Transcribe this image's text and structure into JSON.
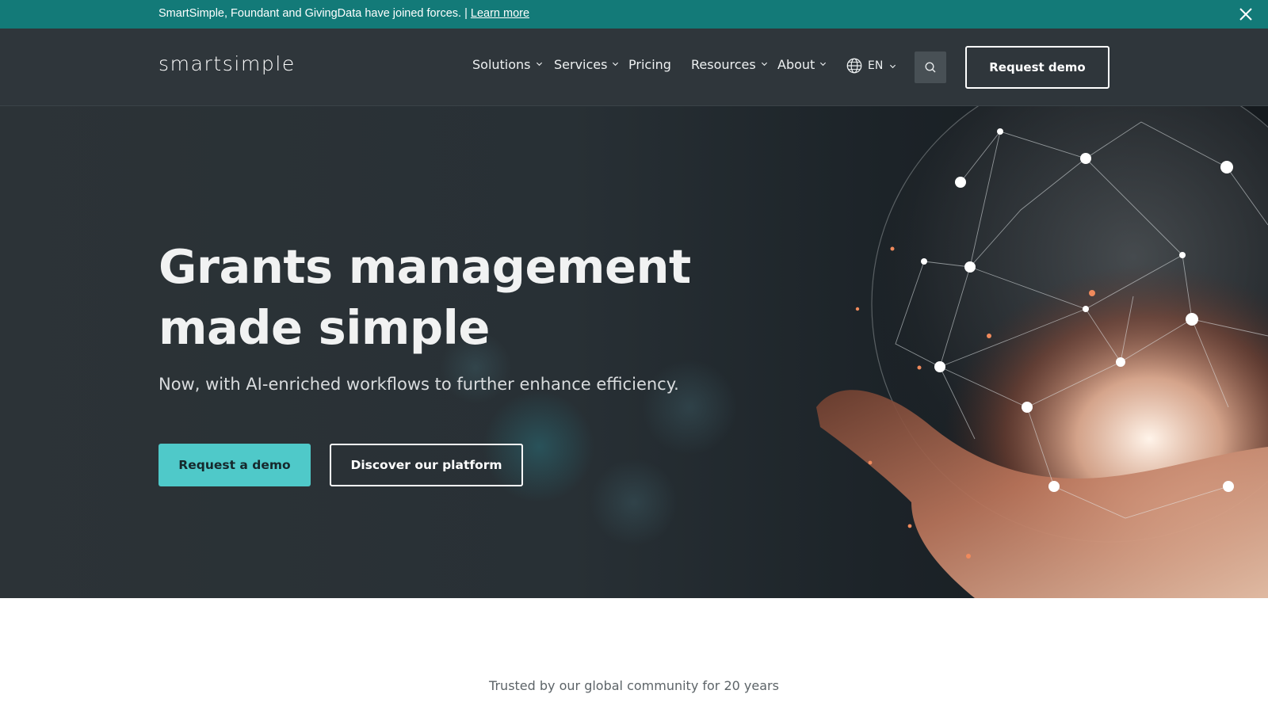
{
  "announcement": {
    "message": "SmartSimple, Foundant and GivingData have joined forces. |",
    "link_label": "Learn more"
  },
  "header": {
    "logo_text": "smartsimple",
    "nav": [
      {
        "label": "Solutions",
        "has_dropdown": true
      },
      {
        "label": "Services",
        "has_dropdown": true
      },
      {
        "label": "Pricing",
        "has_dropdown": false
      },
      {
        "label": "Resources",
        "has_dropdown": true
      },
      {
        "label": "About",
        "has_dropdown": true
      }
    ],
    "language": "EN",
    "cta_label": "Request demo"
  },
  "hero": {
    "title_line1": "Grants management",
    "title_line2": "made simple",
    "subtitle": "Now, with AI-enriched workflows to further enhance efficiency.",
    "primary_cta": "Request a demo",
    "secondary_cta": "Discover our platform"
  },
  "trusted": {
    "text": "Trusted by our global community for 20 years"
  },
  "colors": {
    "announcement_bg": "#137a78",
    "header_bg": "#2f363b",
    "accent": "#4fc9c9",
    "hero_bg": "#283035"
  },
  "icons": {
    "close": "close-icon",
    "chevron": "chevron-down-icon",
    "globe": "globe-icon",
    "search": "search-icon"
  }
}
